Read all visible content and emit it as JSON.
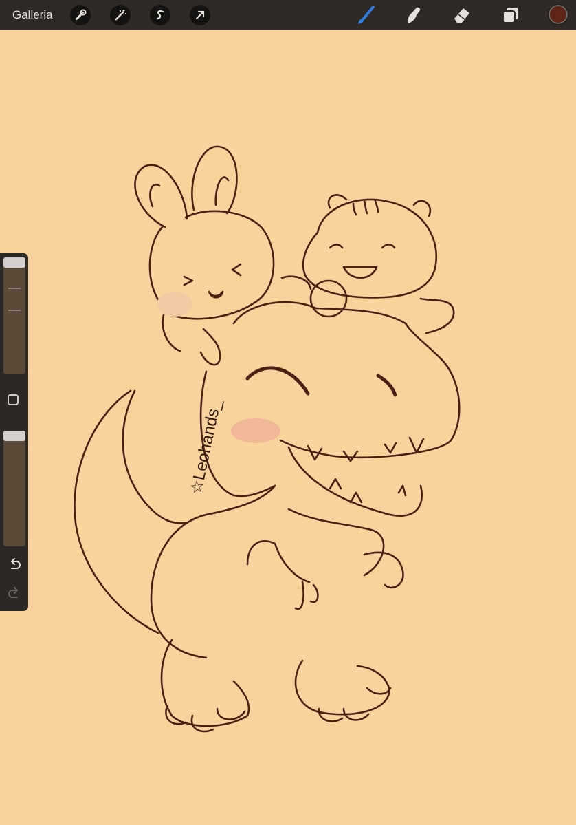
{
  "app": {
    "gallery_label": "Galleria"
  },
  "toolbar_left": [
    "wrench-icon",
    "magic-wand-icon",
    "selection-s-icon",
    "transform-arrow-icon"
  ],
  "toolbar_right": [
    "brush-icon",
    "smudge-icon",
    "eraser-icon",
    "layers-icon",
    "color-swatch"
  ],
  "colors": {
    "active_color": "#5e2518",
    "active_tool": "#2f7de1",
    "canvas_bg": "#fad39c",
    "line": "#4a1f14"
  },
  "sidebar": {
    "brush_size_level": 0.0,
    "opacity_level": 0.0
  },
  "artwork": {
    "signature": "☆Leohands_"
  }
}
